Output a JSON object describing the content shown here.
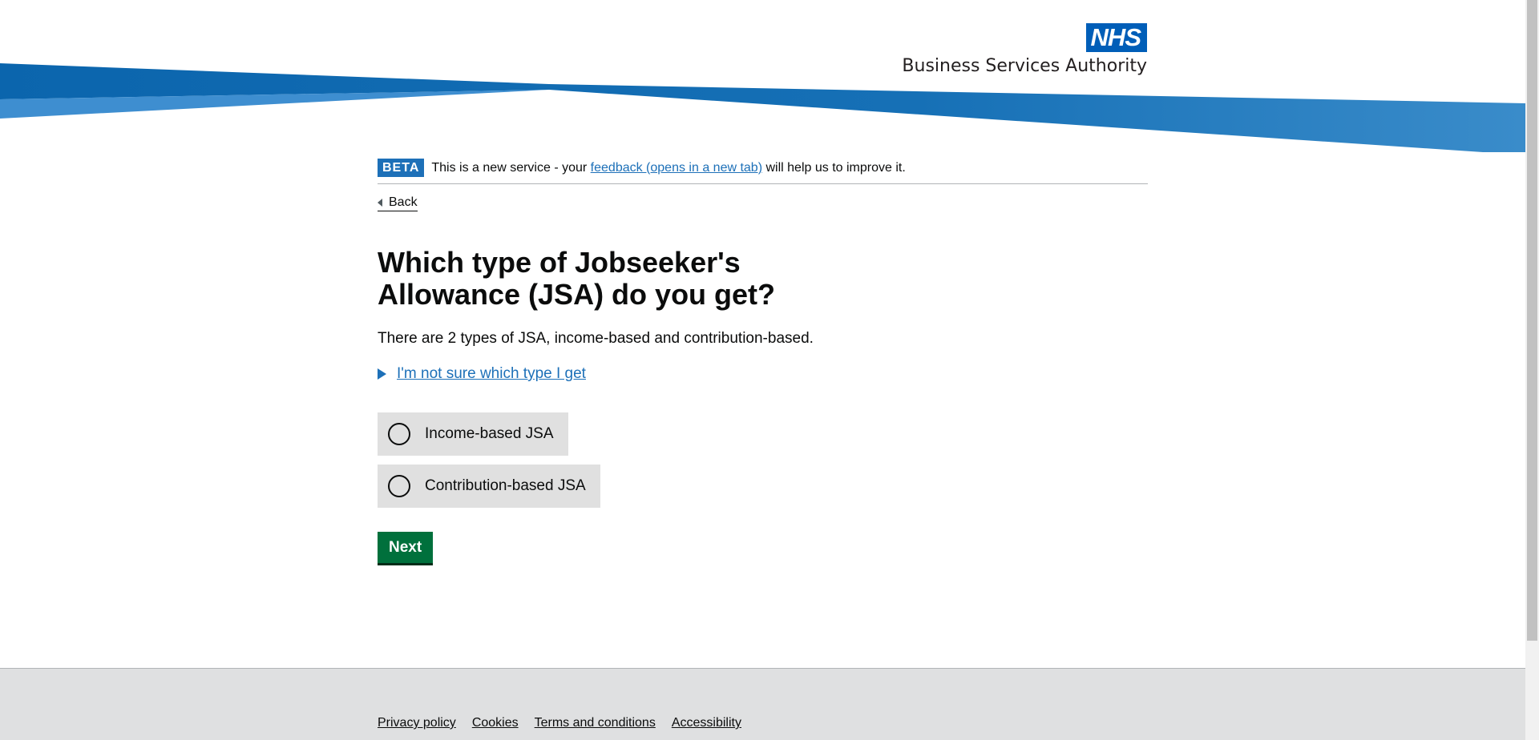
{
  "header": {
    "logo_text": "NHS",
    "org_name": "Business Services Authority"
  },
  "phase_banner": {
    "tag": "BETA",
    "text_before": "This is a new service - your",
    "link_text": "feedback (opens in a new tab)",
    "text_after": "will help us to improve it."
  },
  "back_link": "Back",
  "question": {
    "title": "Which type of Jobseeker's Allowance (JSA) do you get?",
    "hint": "There are 2 types of JSA, income-based and contribution-based.",
    "details_summary": "I'm not sure which type I get",
    "options": [
      {
        "label": "Income-based JSA",
        "selected": false
      },
      {
        "label": "Contribution-based JSA",
        "selected": false
      }
    ]
  },
  "buttons": {
    "next": "Next"
  },
  "footer": {
    "links": [
      "Privacy policy",
      "Cookies",
      "Terms and conditions",
      "Accessibility"
    ]
  },
  "colors": {
    "nhs_blue": "#005eb8",
    "link_blue": "#1d70b8",
    "button_green": "#00703c",
    "radio_bg": "#e0e0e0",
    "footer_bg": "#dfe0e1"
  }
}
